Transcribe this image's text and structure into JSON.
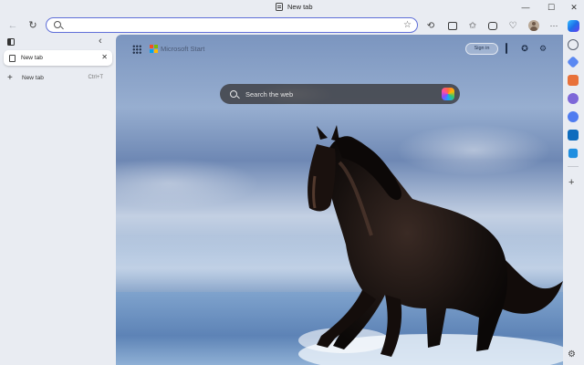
{
  "window": {
    "title": "New tab",
    "controls": {
      "minimize": "—",
      "maximize": "☐",
      "close": "✕"
    }
  },
  "toolbar": {
    "back_icon": "←",
    "refresh_icon": "↻",
    "address_value": "",
    "favorite_icon": "☆",
    "more_icon": "···"
  },
  "vertical_tabs": {
    "collapse_icon": "‹",
    "tabs": [
      {
        "label": "New tab",
        "close": "✕"
      }
    ],
    "new_tab": {
      "label": "New tab",
      "shortcut": "Ctrl+T",
      "icon": "+"
    }
  },
  "new_tab_page": {
    "brand": "Microsoft Start",
    "sign_in": "Sign in",
    "search_placeholder": "Search the web",
    "logo_colors": [
      "#f25022",
      "#7fba00",
      "#00a4ef",
      "#ffb900"
    ]
  },
  "sidebar": {
    "app_colors": [
      "#5a88f2",
      "#e8713a",
      "#7d67d8",
      "#4f7cf0",
      "#0f6cbd",
      "#1f8ee0"
    ],
    "add_icon": "+",
    "settings_icon": "⚙"
  }
}
